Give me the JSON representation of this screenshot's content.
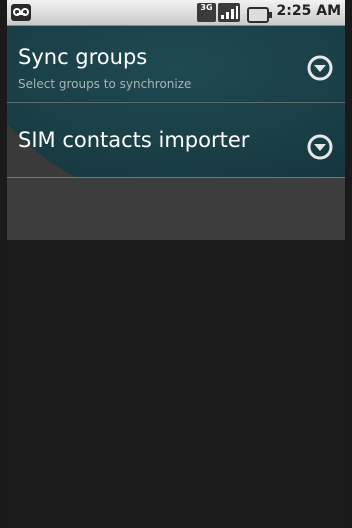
{
  "status_bar": {
    "network_label": "3G",
    "time": "2:25 AM",
    "icons": [
      "voicemail-icon",
      "3g-icon",
      "signal-icon",
      "battery-icon"
    ]
  },
  "list": {
    "items": [
      {
        "title": "Sync groups",
        "subtitle": "Select groups to synchronize",
        "icon": "chevron-down-circle-icon"
      },
      {
        "title": "SIM contacts importer",
        "icon": "chevron-down-circle-icon"
      }
    ]
  }
}
